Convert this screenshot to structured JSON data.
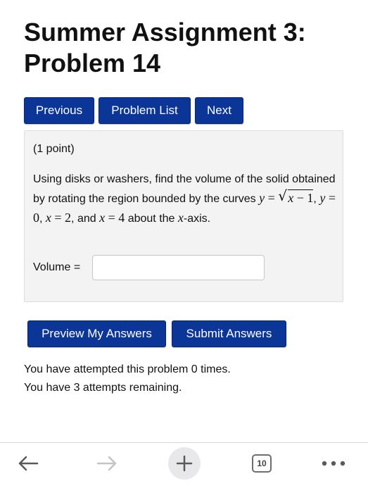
{
  "page": {
    "title": "Summer Assignment 3: Problem 14"
  },
  "nav": {
    "previous": "Previous",
    "problem_list": "Problem List",
    "next": "Next"
  },
  "problem": {
    "points": "(1 point)",
    "text_before_math": "Using disks or washers, find the volume of the solid obtained by rotating the region bounded by the curves ",
    "curve_1": "y = √x − 1",
    "curve_2": "y = 0",
    "curve_3": "x = 2",
    "curve_4": "x = 4",
    "connector_and": "and",
    "text_about": "about the",
    "axis": "x",
    "text_after_axis": "-axis.",
    "answer_label": "Volume =",
    "answer_value": "",
    "answer_placeholder": ""
  },
  "actions": {
    "preview": "Preview My Answers",
    "submit": "Submit Answers"
  },
  "status": {
    "attempted": "You have attempted this problem 0 times.",
    "remaining": "You have 3 attempts remaining."
  },
  "browser_toolbar": {
    "back_icon": "arrow-left-icon",
    "forward_icon": "arrow-right-icon",
    "new_tab_icon": "plus-icon",
    "tab_count": "10",
    "more_icon": "ellipsis-icon"
  },
  "colors": {
    "button_bg": "#0c3598",
    "panel_bg": "#f3f3f3"
  }
}
